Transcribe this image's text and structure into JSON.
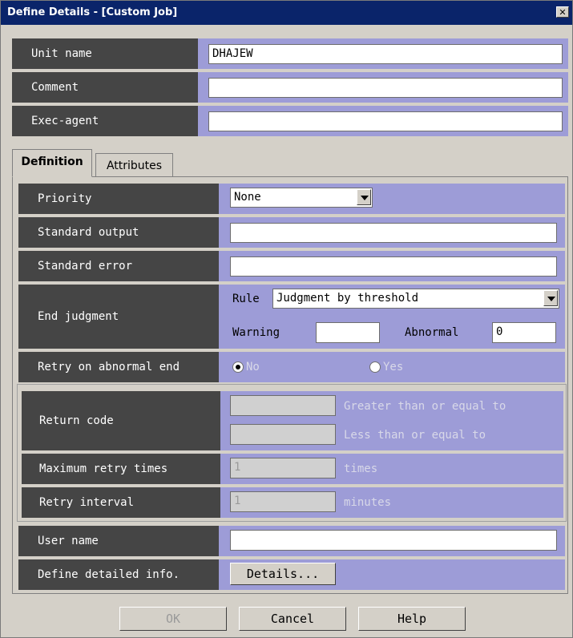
{
  "window": {
    "title": "Define Details - [Custom Job]",
    "close_glyph": "✕"
  },
  "top": {
    "unit_name": {
      "label": "Unit name",
      "value": "DHAJEW"
    },
    "comment": {
      "label": "Comment",
      "value": ""
    },
    "exec_agent": {
      "label": "Exec-agent",
      "value": ""
    }
  },
  "tabs": [
    {
      "label": "Definition",
      "active": true
    },
    {
      "label": "Attributes",
      "active": false
    }
  ],
  "definition": {
    "priority": {
      "label": "Priority",
      "value": "None"
    },
    "standard_output": {
      "label": "Standard output",
      "value": ""
    },
    "standard_error": {
      "label": "Standard error",
      "value": ""
    },
    "end_judgment": {
      "label": "End judgment",
      "rule_label": "Rule",
      "rule_value": "Judgment by threshold",
      "warning_label": "Warning",
      "warning_value": "",
      "abnormal_label": "Abnormal",
      "abnormal_value": "0"
    },
    "retry": {
      "label": "Retry on abnormal end",
      "no_label": "No",
      "yes_label": "Yes",
      "selected": "No"
    },
    "return_code": {
      "label": "Return code",
      "gte_label": "Greater than or equal to",
      "lte_label": "Less than or equal to",
      "gte_value": "",
      "lte_value": ""
    },
    "max_retry": {
      "label": "Maximum retry times",
      "value": "1",
      "unit": "times"
    },
    "retry_interval": {
      "label": "Retry interval",
      "value": "1",
      "unit": "minutes"
    },
    "user_name": {
      "label": "User name",
      "value": ""
    },
    "detailed_info": {
      "label": "Define detailed info.",
      "button": "Details..."
    }
  },
  "footer": {
    "ok": "OK",
    "cancel": "Cancel",
    "help": "Help"
  },
  "colors": {
    "label_bg": "#454545",
    "row_bg": "#9d9cd7",
    "title_bg": "#0a246a",
    "dialog_bg": "#d4d0c8"
  }
}
